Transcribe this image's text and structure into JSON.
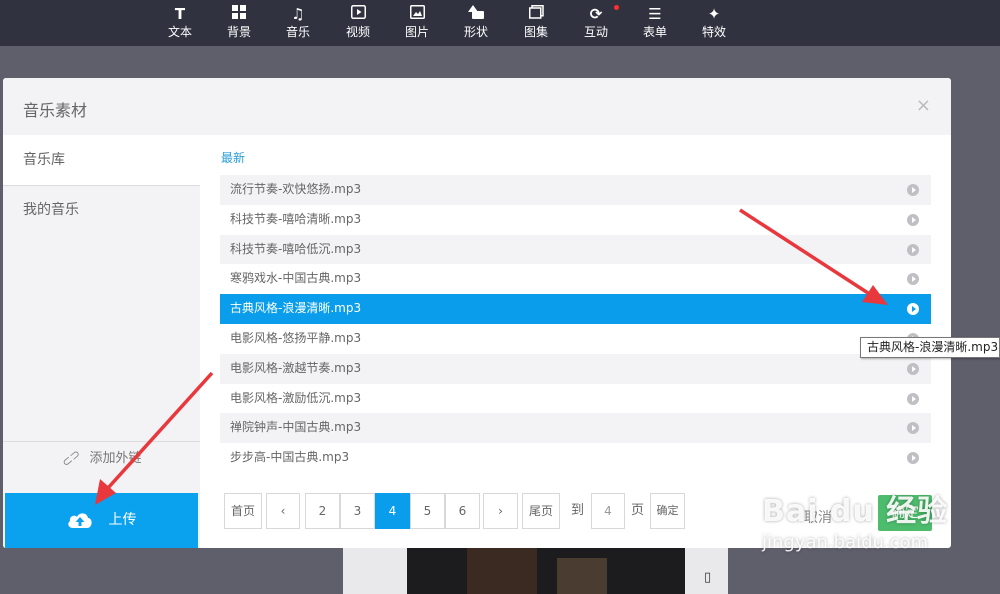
{
  "toolbar": {
    "items": [
      {
        "icon": "text-icon",
        "label": "文本"
      },
      {
        "icon": "background-icon",
        "label": "背景"
      },
      {
        "icon": "music-icon",
        "label": "音乐"
      },
      {
        "icon": "video-icon",
        "label": "视频"
      },
      {
        "icon": "image-icon",
        "label": "图片"
      },
      {
        "icon": "shape-icon",
        "label": "形状"
      },
      {
        "icon": "gallery-icon",
        "label": "图集"
      },
      {
        "icon": "interact-icon",
        "label": "互动"
      },
      {
        "icon": "form-icon",
        "label": "表单"
      },
      {
        "icon": "effects-icon",
        "label": "特效"
      }
    ]
  },
  "modal": {
    "title": "音乐素材",
    "close": "×"
  },
  "sidebar": {
    "items": [
      {
        "label": "音乐库"
      },
      {
        "label": "我的音乐"
      }
    ],
    "add_link_label": "添加外链",
    "upload_label": "上传"
  },
  "content": {
    "section_label": "最新",
    "songs": [
      {
        "name": "流行节奏-欢快悠扬.mp3"
      },
      {
        "name": "科技节奏-嘻哈清晰.mp3"
      },
      {
        "name": "科技节奏-嘻哈低沉.mp3"
      },
      {
        "name": "寒鸦戏水-中国古典.mp3"
      },
      {
        "name": "古典风格-浪漫清晰.mp3"
      },
      {
        "name": "电影风格-悠扬平静.mp3"
      },
      {
        "name": "电影风格-激越节奏.mp3"
      },
      {
        "name": "电影风格-激励低沉.mp3"
      },
      {
        "name": "禅院钟声-中国古典.mp3"
      },
      {
        "name": "步步高-中国古典.mp3"
      }
    ],
    "selected_song": "古典风格-浪漫清晰.mp3"
  },
  "pagination": {
    "first": "首页",
    "prev": "‹",
    "pages": [
      "2",
      "3",
      "4",
      "5",
      "6"
    ],
    "current": "4",
    "next": "›",
    "last": "尾页",
    "goto_prefix": "到",
    "goto_value": "4",
    "goto_suffix": "页",
    "goto_confirm": "确定"
  },
  "actions": {
    "cancel": "取消",
    "confirm": "确定"
  },
  "tooltip": "古典风格-浪漫清晰.mp3",
  "colors": {
    "accent": "#0a9deb",
    "confirm": "#4dbd6d",
    "annotation_arrow": "#e8383d"
  },
  "watermark": {
    "logo": "Bai du 经验",
    "url": "jingyan.baidu.com"
  }
}
